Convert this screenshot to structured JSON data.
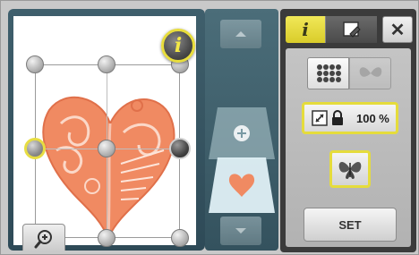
{
  "info_button_label": "i",
  "right_panel": {
    "tabs": [
      {
        "label": "i",
        "icon": "info-icon",
        "active": true
      },
      {
        "label": "",
        "icon": "edit-pattern-icon",
        "active": false
      }
    ],
    "close_label": "✕",
    "scale_value": "100 %",
    "set_label": "SET"
  },
  "icons": {
    "zoom": "zoom-in-icon",
    "scroll_up": "triangle-up-icon",
    "scroll_down": "triangle-down-icon",
    "add_layer": "plus-icon",
    "lock": "lock-icon",
    "resize": "resize-icon",
    "butterfly": "butterfly-icon"
  },
  "colors": {
    "accent_yellow": "#e5dc3c",
    "pattern_color": "#f08a62"
  }
}
